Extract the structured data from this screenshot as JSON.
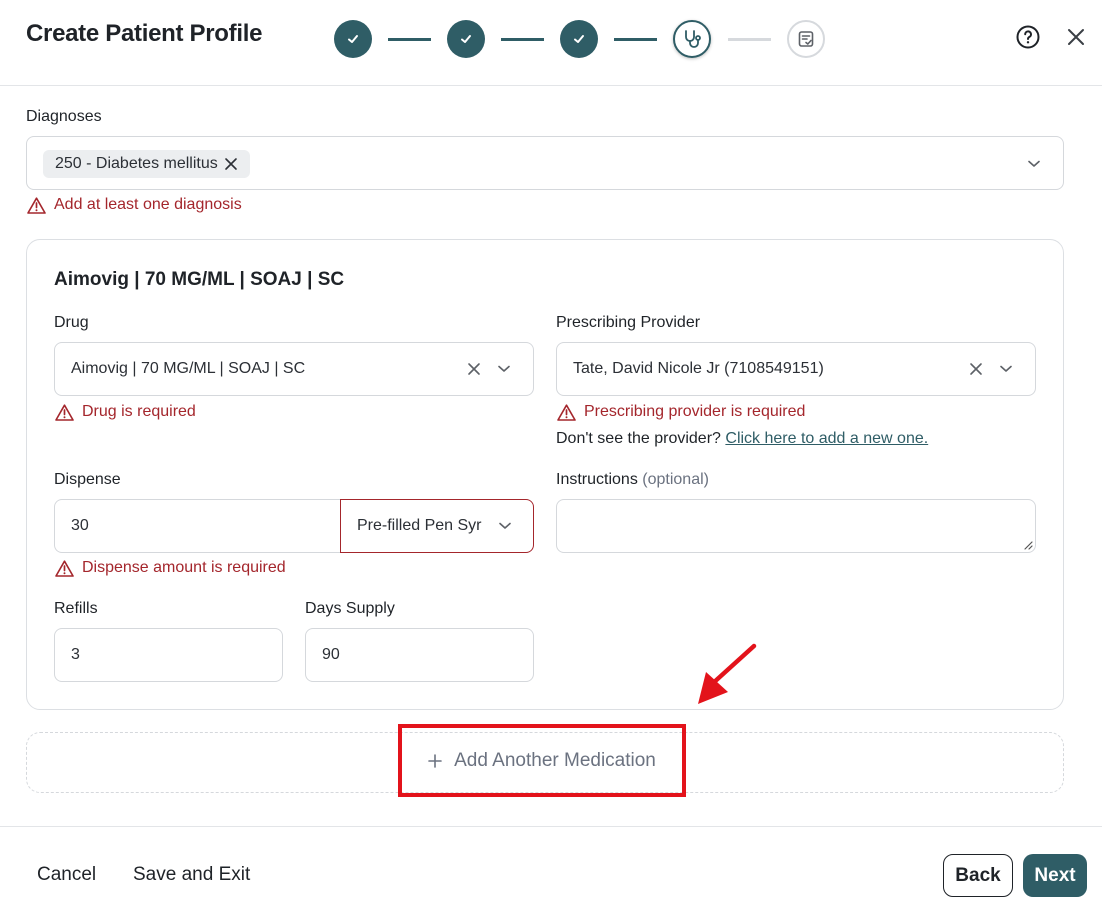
{
  "header": {
    "title": "Create Patient Profile",
    "steps": [
      "complete",
      "complete",
      "complete",
      "current",
      "upcoming"
    ],
    "step_icons": [
      "check-icon",
      "check-icon",
      "check-icon",
      "stethoscope-icon",
      "clipboard-check-icon"
    ],
    "help_icon": "question-circle-icon",
    "close_icon": "close-icon"
  },
  "diagnoses": {
    "label": "Diagnoses",
    "chip": "250 - Diabetes mellitus",
    "error": "Add at least one diagnosis"
  },
  "medication": {
    "title": "Aimovig | 70 MG/ML | SOAJ | SC",
    "drug": {
      "label": "Drug",
      "value": "Aimovig | 70 MG/ML | SOAJ | SC",
      "error": "Drug is required"
    },
    "provider": {
      "label": "Prescribing Provider",
      "value": "Tate, David Nicole Jr (7108549151)",
      "error": "Prescribing provider is required",
      "note": "Don't see the provider?",
      "note_link": "Click here to add a new one."
    },
    "dispense": {
      "label": "Dispense",
      "amount": "30",
      "unit": "Pre-filled Pen Syr",
      "error": "Dispense amount is required"
    },
    "instructions": {
      "label": "Instructions",
      "optional": "(optional)",
      "value": ""
    },
    "refills": {
      "label": "Refills",
      "value": "3"
    },
    "days_supply": {
      "label": "Days Supply",
      "value": "90"
    }
  },
  "add_medication": {
    "label": "Add Another Medication"
  },
  "footer": {
    "cancel": "Cancel",
    "save_exit": "Save and Exit",
    "back": "Back",
    "next": "Next"
  },
  "colors": {
    "primary": "#2f5d66",
    "error": "#a4262c",
    "highlight": "#e3131b"
  }
}
